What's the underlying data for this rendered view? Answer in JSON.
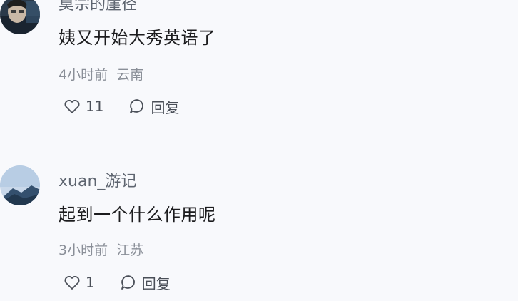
{
  "comments": [
    {
      "username": "莫宗的崖径",
      "content": "姨又开始大秀英语了",
      "time": "4小时前",
      "location": "云南",
      "like_count": "11",
      "reply_label": "回复"
    },
    {
      "username": "xuan_游记",
      "content": "起到一个什么作用呢",
      "time": "3小时前",
      "location": "江苏",
      "like_count": "1",
      "reply_label": "回复"
    }
  ],
  "icons": {
    "like": "heart-outline",
    "reply": "speech-bubble-outline"
  },
  "colors": {
    "background": "#f8f9fc",
    "text": "#1c1c1e",
    "meta": "#8a8f98"
  }
}
